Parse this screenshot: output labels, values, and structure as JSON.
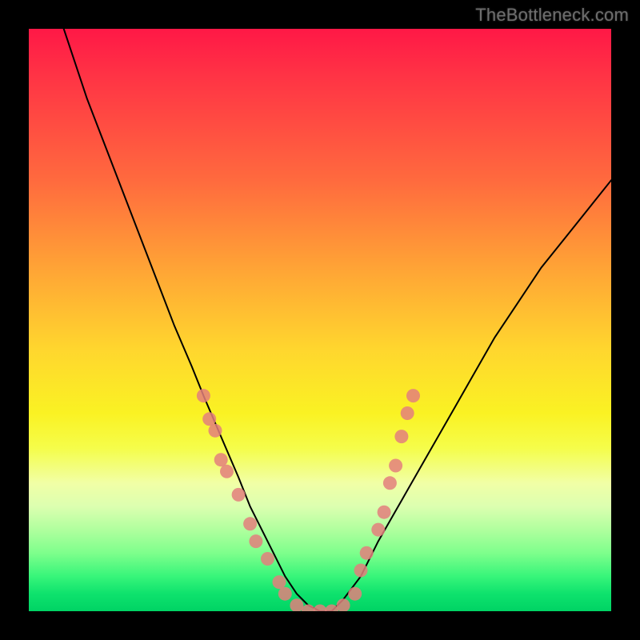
{
  "watermark": "TheBottleneck.com",
  "chart_data": {
    "type": "line",
    "title": "",
    "xlabel": "",
    "ylabel": "",
    "xlim": [
      0,
      100
    ],
    "ylim": [
      0,
      100
    ],
    "series": [
      {
        "name": "curve",
        "x": [
          6,
          10,
          15,
          20,
          25,
          28,
          30,
          33,
          36,
          38,
          40,
          42,
          44,
          46,
          48,
          50,
          52,
          54,
          57,
          60,
          64,
          68,
          72,
          76,
          80,
          84,
          88,
          92,
          96,
          100
        ],
        "y": [
          100,
          88,
          75,
          62,
          49,
          42,
          37,
          30,
          23,
          18,
          14,
          10,
          6,
          3,
          1,
          0,
          0,
          2,
          6,
          12,
          19,
          26,
          33,
          40,
          47,
          53,
          59,
          64,
          69,
          74
        ]
      }
    ],
    "scatter": {
      "name": "data-points",
      "color": "#e37f7c",
      "points": [
        {
          "x": 30,
          "y": 37
        },
        {
          "x": 31,
          "y": 33
        },
        {
          "x": 32,
          "y": 31
        },
        {
          "x": 33,
          "y": 26
        },
        {
          "x": 34,
          "y": 24
        },
        {
          "x": 36,
          "y": 20
        },
        {
          "x": 38,
          "y": 15
        },
        {
          "x": 39,
          "y": 12
        },
        {
          "x": 41,
          "y": 9
        },
        {
          "x": 43,
          "y": 5
        },
        {
          "x": 44,
          "y": 3
        },
        {
          "x": 46,
          "y": 1
        },
        {
          "x": 48,
          "y": 0
        },
        {
          "x": 50,
          "y": 0
        },
        {
          "x": 52,
          "y": 0
        },
        {
          "x": 54,
          "y": 1
        },
        {
          "x": 56,
          "y": 3
        },
        {
          "x": 57,
          "y": 7
        },
        {
          "x": 58,
          "y": 10
        },
        {
          "x": 60,
          "y": 14
        },
        {
          "x": 61,
          "y": 17
        },
        {
          "x": 62,
          "y": 22
        },
        {
          "x": 63,
          "y": 25
        },
        {
          "x": 64,
          "y": 30
        },
        {
          "x": 65,
          "y": 34
        },
        {
          "x": 66,
          "y": 37
        }
      ]
    }
  }
}
